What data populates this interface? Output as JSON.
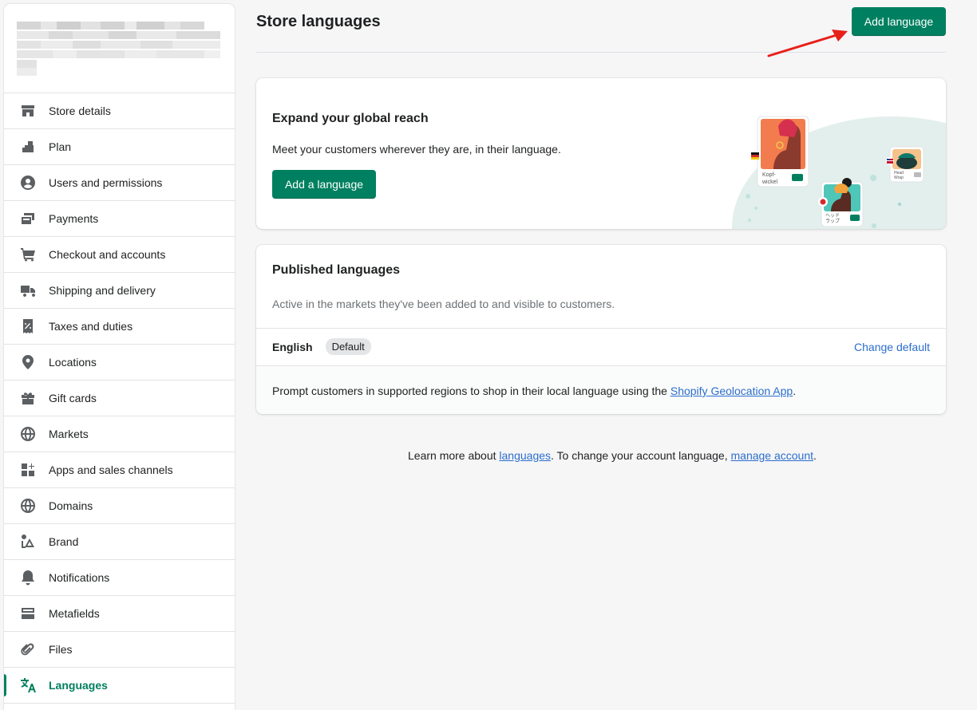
{
  "sidebar": {
    "items": [
      {
        "label": "Store details",
        "icon": "store-icon"
      },
      {
        "label": "Plan",
        "icon": "plan-icon"
      },
      {
        "label": "Users and permissions",
        "icon": "user-circle-icon"
      },
      {
        "label": "Payments",
        "icon": "payments-icon"
      },
      {
        "label": "Checkout and accounts",
        "icon": "cart-icon"
      },
      {
        "label": "Shipping and delivery",
        "icon": "truck-icon"
      },
      {
        "label": "Taxes and duties",
        "icon": "receipt-percent-icon"
      },
      {
        "label": "Locations",
        "icon": "location-pin-icon"
      },
      {
        "label": "Gift cards",
        "icon": "gift-icon"
      },
      {
        "label": "Markets",
        "icon": "globe-markets-icon"
      },
      {
        "label": "Apps and sales channels",
        "icon": "apps-icon"
      },
      {
        "label": "Domains",
        "icon": "globe-icon"
      },
      {
        "label": "Brand",
        "icon": "brand-icon"
      },
      {
        "label": "Notifications",
        "icon": "bell-icon"
      },
      {
        "label": "Metafields",
        "icon": "metafields-icon"
      },
      {
        "label": "Files",
        "icon": "paperclip-icon"
      },
      {
        "label": "Languages",
        "icon": "translate-icon",
        "active": true
      }
    ]
  },
  "header": {
    "title": "Store languages",
    "add_button": "Add language"
  },
  "promo": {
    "title": "Expand your global reach",
    "text": "Meet your customers wherever they are, in their language.",
    "button": "Add a language",
    "card_labels": [
      "Kopf-\nwickel",
      "ヘッド\nラップ",
      "Head\nWrap"
    ]
  },
  "published": {
    "title": "Published languages",
    "subtitle": "Active in the markets they've been added to and visible to customers.",
    "language": "English",
    "badge": "Default",
    "change_default": "Change default",
    "prompt_prefix": "Prompt customers in supported regions to shop in their local language using the ",
    "prompt_link": "Shopify Geolocation App",
    "prompt_suffix": "."
  },
  "footer": {
    "prefix": "Learn more about ",
    "languages_link": "languages",
    "middle": ". To change your account language, ",
    "account_link": "manage account",
    "suffix": "."
  },
  "colors": {
    "primary": "#008060",
    "active_nav": "#007f5f",
    "link": "#2c6ecb",
    "arrow": "#e8201a"
  }
}
